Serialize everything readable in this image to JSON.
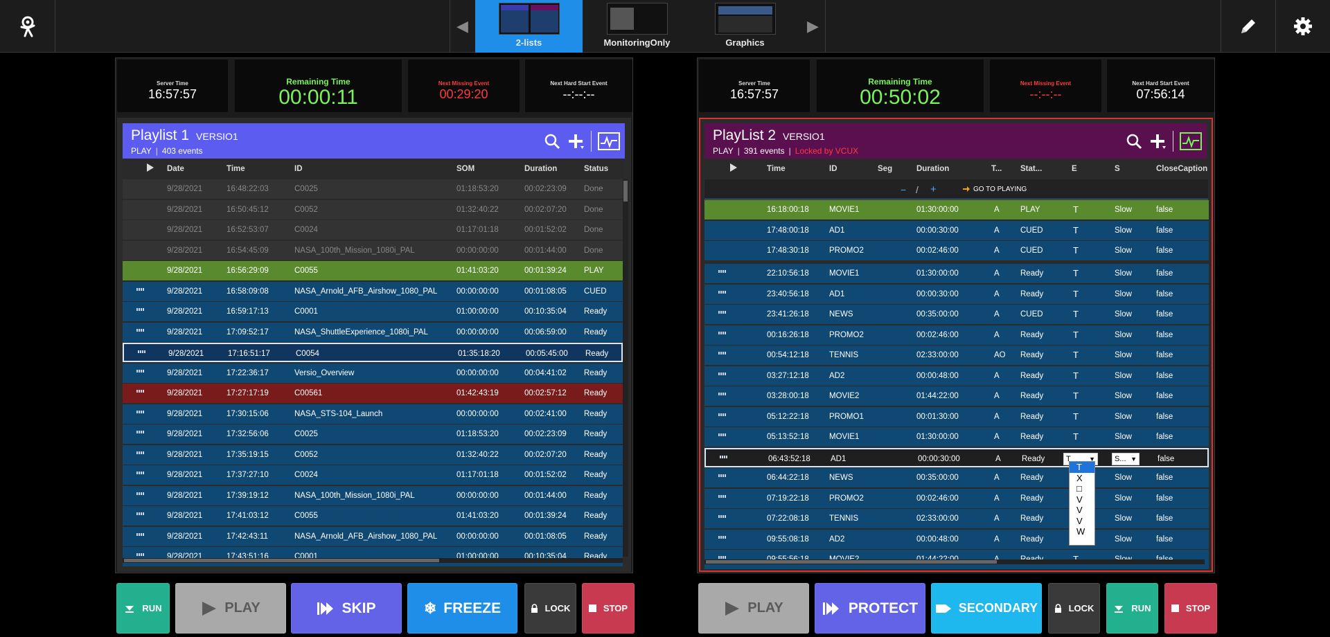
{
  "topbar": {
    "tabs": [
      {
        "label": "2-lists",
        "active": true
      },
      {
        "label": "MonitoringOnly",
        "active": false
      },
      {
        "label": "Graphics",
        "active": false
      }
    ],
    "left_arrow": "◀",
    "right_arrow": "▶"
  },
  "colors": {
    "accent": "#1e8ee8",
    "playlist1_header": "#5c5cf0",
    "playlist2_header": "#5a0f4f",
    "remaining_green": "#7cf25a",
    "missing_red": "#ff3b3b",
    "row_play": "#5a8a2e",
    "row_ready": "#104874"
  },
  "panel1": {
    "clocks": {
      "server_label": "Server Time",
      "server_value": "16:57:57",
      "remaining_label": "Remaining Time",
      "remaining_value": "00:00:11",
      "missing_label": "Next Missing Event",
      "missing_value": "00:29:20",
      "hardstart_label": "Next Hard Start Event",
      "hardstart_value": "--:--:--"
    },
    "title": "Playlist 1",
    "subtitle": "VERSIO1",
    "mode": "PLAY",
    "events": "403 events",
    "columns": {
      "date": "Date",
      "time": "Time",
      "id": "ID",
      "som": "SOM",
      "duration": "Duration",
      "status": "Status"
    },
    "rows": [
      {
        "date": "9/28/2021",
        "time": "16:48:22:03",
        "id": "C0025",
        "som": "01:18:53:20",
        "duration": "00:02:23:09",
        "status": "Done"
      },
      {
        "date": "9/28/2021",
        "time": "16:50:45:12",
        "id": "C0052",
        "som": "01:32:40:22",
        "duration": "00:02:07:20",
        "status": "Done"
      },
      {
        "date": "9/28/2021",
        "time": "16:52:53:07",
        "id": "C0024",
        "som": "01:17:01:18",
        "duration": "00:01:52:02",
        "status": "Done"
      },
      {
        "date": "9/28/2021",
        "time": "16:54:45:09",
        "id": "NASA_100th_Mission_1080i_PAL",
        "som": "00:00:00:00",
        "duration": "00:01:44:00",
        "status": "Done"
      },
      {
        "date": "9/28/2021",
        "time": "16:56:29:09",
        "id": "C0055",
        "som": "01:41:03:20",
        "duration": "00:01:39:24",
        "status": "PLAY"
      },
      {
        "date": "9/28/2021",
        "time": "16:58:09:08",
        "id": "NASA_Arnold_AFB_Airshow_1080_PAL",
        "som": "00:00:00:00",
        "duration": "00:01:08:05",
        "status": "CUED"
      },
      {
        "date": "9/28/2021",
        "time": "16:59:17:13",
        "id": "C0001",
        "som": "01:00:00:00",
        "duration": "00:10:35:04",
        "status": "Ready"
      },
      {
        "date": "9/28/2021",
        "time": "17:09:52:17",
        "id": "NASA_ShuttleExperience_1080i_PAL",
        "som": "00:00:00:00",
        "duration": "00:06:59:00",
        "status": "Ready"
      },
      {
        "date": "9/28/2021",
        "time": "17:16:51:17",
        "id": "C0054",
        "som": "01:35:18:20",
        "duration": "00:05:45:00",
        "status": "Ready"
      },
      {
        "date": "9/28/2021",
        "time": "17:22:36:17",
        "id": "Versio_Overview",
        "som": "00:00:00:00",
        "duration": "00:04:41:02",
        "status": "Ready"
      },
      {
        "date": "9/28/2021",
        "time": "17:27:17:19",
        "id": "C00561",
        "som": "01:42:43:19",
        "duration": "00:02:57:12",
        "status": "Ready"
      },
      {
        "date": "9/28/2021",
        "time": "17:30:15:06",
        "id": "NASA_STS-104_Launch",
        "som": "00:00:00:00",
        "duration": "00:02:41:00",
        "status": "Ready"
      },
      {
        "date": "9/28/2021",
        "time": "17:32:56:06",
        "id": "C0025",
        "som": "01:18:53:20",
        "duration": "00:02:23:09",
        "status": "Ready"
      },
      {
        "date": "9/28/2021",
        "time": "17:35:19:15",
        "id": "C0052",
        "som": "01:32:40:22",
        "duration": "00:02:07:20",
        "status": "Ready"
      },
      {
        "date": "9/28/2021",
        "time": "17:37:27:10",
        "id": "C0024",
        "som": "01:17:01:18",
        "duration": "00:01:52:02",
        "status": "Ready"
      },
      {
        "date": "9/28/2021",
        "time": "17:39:19:12",
        "id": "NASA_100th_Mission_1080i_PAL",
        "som": "00:00:00:00",
        "duration": "00:01:44:00",
        "status": "Ready"
      },
      {
        "date": "9/28/2021",
        "time": "17:41:03:12",
        "id": "C0055",
        "som": "01:41:03:20",
        "duration": "00:01:39:24",
        "status": "Ready"
      },
      {
        "date": "9/28/2021",
        "time": "17:42:43:11",
        "id": "NASA_Arnold_AFB_Airshow_1080_PAL",
        "som": "00:00:00:00",
        "duration": "00:01:08:05",
        "status": "Ready"
      },
      {
        "date": "9/28/2021",
        "time": "17:43:51:16",
        "id": "C0001",
        "som": "01:00:00:00",
        "duration": "00:10:35:04",
        "status": "Ready"
      }
    ]
  },
  "panel2": {
    "clocks": {
      "server_label": "Server Time",
      "server_value": "16:57:57",
      "remaining_label": "Remaining Time",
      "remaining_value": "00:50:02",
      "missing_label": "Next Missing Event",
      "missing_value": "--:--:--",
      "hardstart_label": "Next Hard Start Event",
      "hardstart_value": "07:56:14"
    },
    "title": "PlayList 2",
    "subtitle": "VERSIO1",
    "mode": "PLAY",
    "events": "391 events",
    "locked": "Locked by VCUX",
    "columns": {
      "time": "Time",
      "id": "ID",
      "seg": "Seg",
      "duration": "Duration",
      "t": "T...",
      "stat": "Stat...",
      "e": "E",
      "s": "S",
      "cc": "CloseCaption"
    },
    "nav": {
      "minus": "−",
      "slash": "/",
      "plus": "+",
      "goto": "GO TO PLAYING"
    },
    "top_rows": [
      {
        "time": "16:18:00:18",
        "id": "MOVIE1",
        "duration": "01:30:00:00",
        "t": "A",
        "stat": "PLAY",
        "e": "T",
        "s": "Slow",
        "cc": "false"
      },
      {
        "time": "17:48:00:18",
        "id": "AD1",
        "duration": "00:00:30:00",
        "t": "A",
        "stat": "CUED",
        "e": "T",
        "s": "Slow",
        "cc": "false"
      },
      {
        "time": "17:48:30:18",
        "id": "PROMO2",
        "duration": "00:02:46:00",
        "t": "A",
        "stat": "CUED",
        "e": "T",
        "s": "Slow",
        "cc": "false"
      }
    ],
    "rows": [
      {
        "time": "22:10:56:18",
        "id": "MOVIE1",
        "duration": "01:30:00:00",
        "t": "A",
        "stat": "Ready",
        "e": "T",
        "s": "Slow",
        "cc": "false"
      },
      {
        "time": "23:40:56:18",
        "id": "AD1",
        "duration": "00:00:30:00",
        "t": "A",
        "stat": "Ready",
        "e": "T",
        "s": "Slow",
        "cc": "false"
      },
      {
        "time": "23:41:26:18",
        "id": "NEWS",
        "duration": "00:35:00:00",
        "t": "A",
        "stat": "CUED",
        "e": "T",
        "s": "Slow",
        "cc": "false"
      },
      {
        "time": "00:16:26:18",
        "id": "PROMO2",
        "duration": "00:02:46:00",
        "t": "A",
        "stat": "Ready",
        "e": "T",
        "s": "Slow",
        "cc": "false"
      },
      {
        "time": "00:54:12:18",
        "id": "TENNIS",
        "duration": "02:33:00:00",
        "t": "AO",
        "stat": "Ready",
        "e": "T",
        "s": "Slow",
        "cc": "false"
      },
      {
        "time": "03:27:12:18",
        "id": "AD2",
        "duration": "00:00:48:00",
        "t": "A",
        "stat": "Ready",
        "e": "T",
        "s": "Slow",
        "cc": "false"
      },
      {
        "time": "03:28:00:18",
        "id": "MOVIE2",
        "duration": "01:44:22:00",
        "t": "A",
        "stat": "Ready",
        "e": "T",
        "s": "Slow",
        "cc": "false"
      },
      {
        "time": "05:12:22:18",
        "id": "PROMO1",
        "duration": "00:01:30:00",
        "t": "A",
        "stat": "Ready",
        "e": "T",
        "s": "Slow",
        "cc": "false"
      },
      {
        "time": "05:13:52:18",
        "id": "MOVIE1",
        "duration": "01:30:00:00",
        "t": "A",
        "stat": "Ready",
        "e": "T",
        "s": "Slow",
        "cc": "false"
      },
      {
        "time": "06:43:52:18",
        "id": "AD1",
        "duration": "00:00:30:00",
        "t": "A",
        "stat": "Ready",
        "e": "T",
        "s": "S...",
        "cc": "false"
      },
      {
        "time": "06:44:22:18",
        "id": "NEWS",
        "duration": "00:35:00:00",
        "t": "A",
        "stat": "Ready",
        "e": "T",
        "s": "Slow",
        "cc": "false"
      },
      {
        "time": "07:19:22:18",
        "id": "PROMO2",
        "duration": "00:02:46:00",
        "t": "A",
        "stat": "Ready",
        "e": "T",
        "s": "Slow",
        "cc": "false"
      },
      {
        "time": "07:22:08:18",
        "id": "TENNIS",
        "duration": "02:33:00:00",
        "t": "A",
        "stat": "Ready",
        "e": "T",
        "s": "Slow",
        "cc": "false"
      },
      {
        "time": "09:55:08:18",
        "id": "AD2",
        "duration": "00:00:48:00",
        "t": "A",
        "stat": "Ready",
        "e": "T",
        "s": "Slow",
        "cc": "false"
      },
      {
        "time": "09:55:56:18",
        "id": "MOVIE2",
        "duration": "01:44:22:00",
        "t": "A",
        "stat": "Ready",
        "e": "T",
        "s": "Slow",
        "cc": "false"
      }
    ],
    "dropdown_options": [
      "T",
      "X",
      "□",
      "V",
      "V",
      "V",
      "W"
    ]
  },
  "buttons_left": [
    {
      "label": "RUN",
      "icon": "run-icon"
    },
    {
      "label": "PLAY",
      "icon": "play-icon"
    },
    {
      "label": "SKIP",
      "icon": "skip-icon"
    },
    {
      "label": "FREEZE",
      "icon": "snowflake-icon"
    },
    {
      "label": "LOCK",
      "icon": "lock-icon"
    },
    {
      "label": "STOP",
      "icon": "stop-icon"
    }
  ],
  "buttons_right": [
    {
      "label": "PLAY",
      "icon": "play-icon"
    },
    {
      "label": "PROTECT",
      "icon": "protect-icon"
    },
    {
      "label": "SECONDARY",
      "icon": "secondary-icon"
    },
    {
      "label": "LOCK",
      "icon": "lock-icon"
    },
    {
      "label": "RUN",
      "icon": "run-icon"
    },
    {
      "label": "STOP",
      "icon": "stop-icon"
    }
  ]
}
